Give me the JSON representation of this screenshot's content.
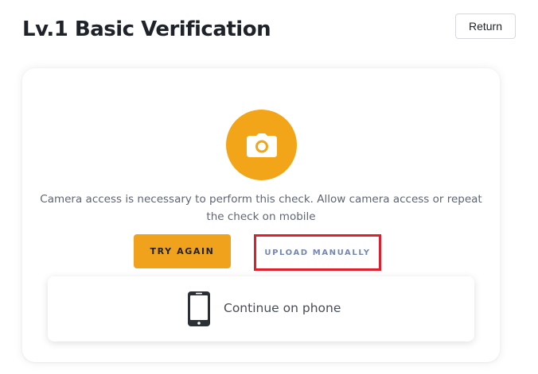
{
  "header": {
    "title": "Lv.1 Basic Verification",
    "return_label": "Return"
  },
  "verification": {
    "icon": "camera-icon",
    "message": "Camera access is necessary to perform this check. Allow camera access or repeat the check on mobile",
    "try_again_label": "TRY AGAIN",
    "upload_manually_label": "UPLOAD MANUALLY",
    "continue_on_phone": {
      "icon": "phone-icon",
      "label": "Continue on phone"
    }
  },
  "colors": {
    "accent": "#f0a21c",
    "camera_circle": "#f3a519",
    "upload_link": "#7487b4",
    "highlight_border": "#e01f2e",
    "title_text": "#1e2329",
    "message_text": "#5e6673"
  }
}
